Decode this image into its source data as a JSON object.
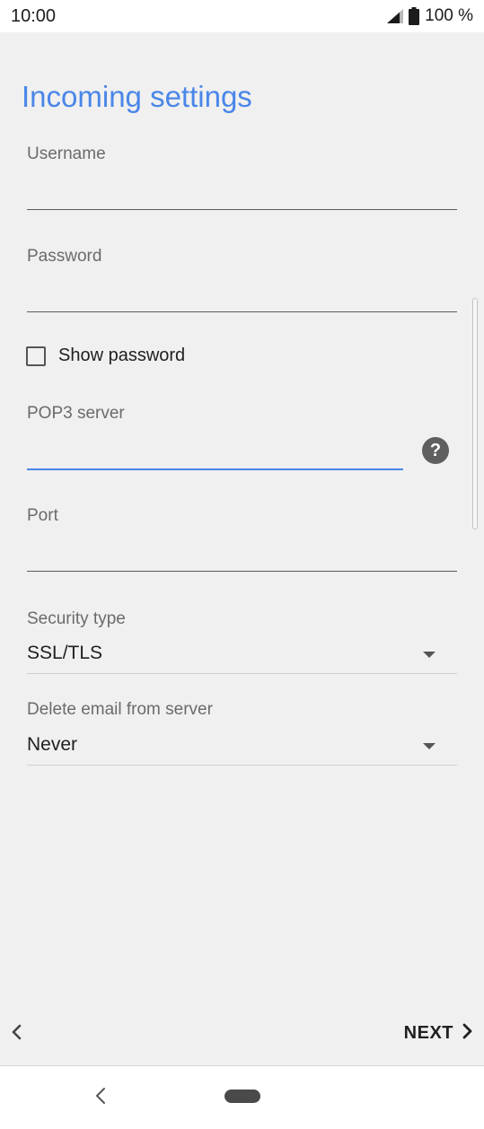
{
  "status_bar": {
    "time": "10:00",
    "battery": "100 %",
    "icons": [
      "signal-icon",
      "battery-icon"
    ]
  },
  "title": "Incoming settings",
  "fields": {
    "username": {
      "label": "Username",
      "value": ""
    },
    "password": {
      "label": "Password",
      "value": ""
    },
    "show_password": {
      "label": "Show password",
      "checked": false
    },
    "pop3_server": {
      "label": "POP3 server",
      "value": "",
      "help_icon": "help-icon"
    },
    "port": {
      "label": "Port",
      "value": ""
    },
    "security_type": {
      "label": "Security type",
      "value": "SSL/TLS"
    },
    "delete_email": {
      "label": "Delete email from server",
      "value": "Never"
    }
  },
  "wizard_nav": {
    "back_icon": "chevron-left-icon",
    "next_label": "NEXT",
    "next_icon": "chevron-right-icon"
  },
  "system_nav": {
    "back_icon": "back-icon",
    "home_icon": "home-pill-icon"
  },
  "colors": {
    "accent": "#4a86e8",
    "background": "#f0f0f0"
  }
}
